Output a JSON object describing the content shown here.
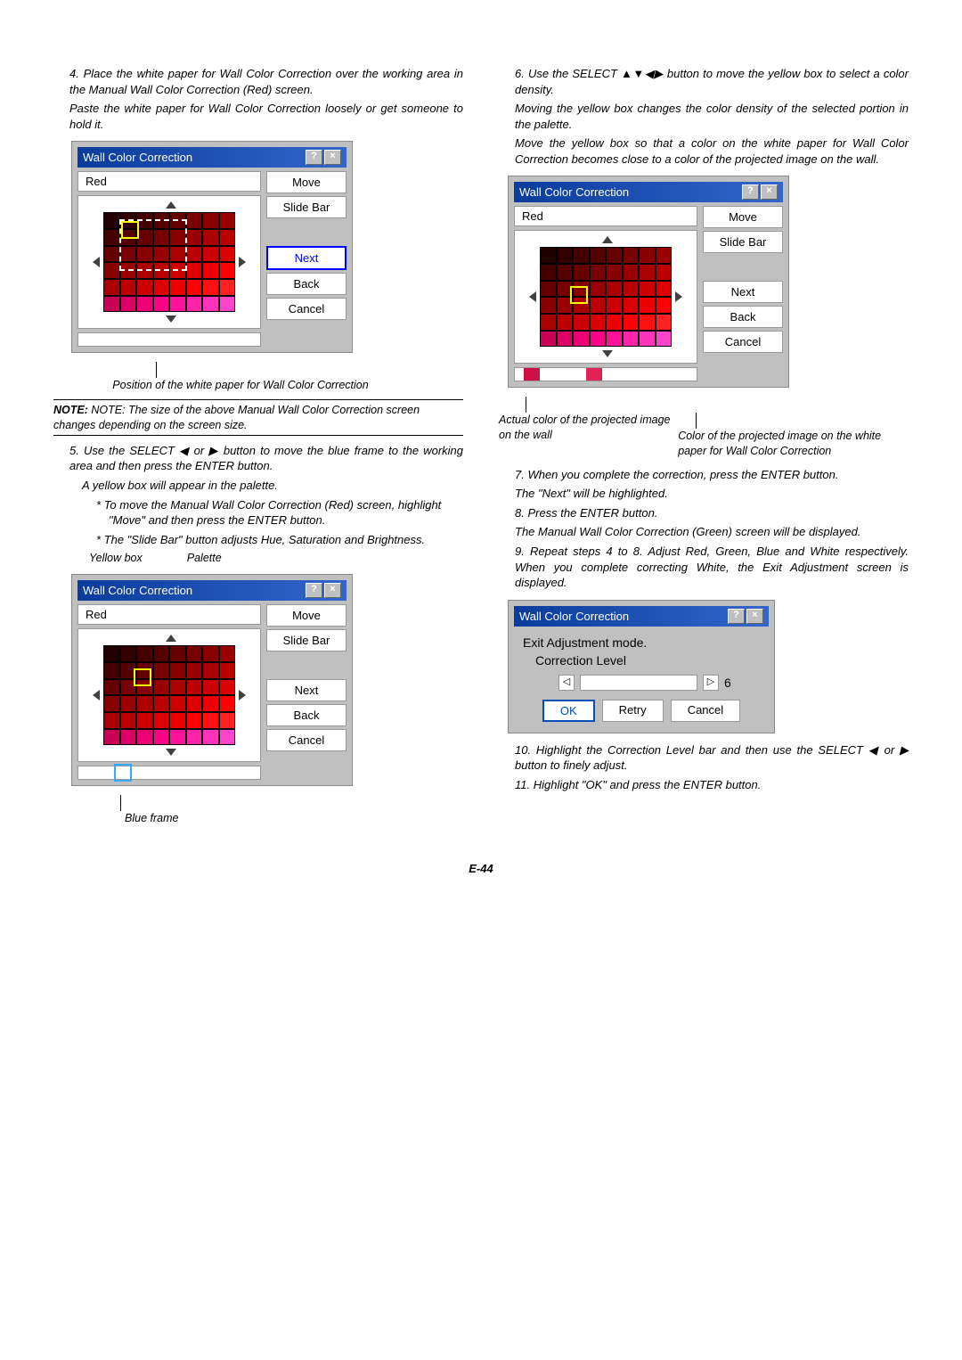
{
  "page_number": "E-44",
  "left": {
    "s4a": "4. Place the white paper for Wall Color Correction over the working area in the Manual Wall Color Correction (Red) screen.",
    "s4b": "Paste the white paper for Wall Color Correction loosely or get someone to hold it.",
    "dlg1_caption": "Position of the white paper for Wall Color Correction",
    "note": "NOTE: The size of the above Manual Wall Color Correction screen changes depending on the screen size.",
    "s5a": "5. Use the SELECT ◀ or ▶ button to move the blue frame to the working area and then press the ENTER button.",
    "s5b": "A yellow box will appear in the palette.",
    "s5c": "*   To move the Manual Wall Color Correction (Red) screen, highlight \"Move\" and then press the ENTER button.",
    "s5d": "*   The \"Slide Bar\" button adjusts Hue, Saturation and Brightness.",
    "annot_yellow": "Yellow box",
    "annot_palette": "Palette",
    "annot_blue": "Blue frame"
  },
  "right": {
    "s6a": "6. Use the SELECT ▲▼◀▶ button to move the yellow box to select a color density.",
    "s6b": "Moving the yellow box changes the color density of the selected portion in the palette.",
    "s6c": "Move the yellow box so that a color on the white paper for Wall Color Correction becomes close to a color of the projected image on the wall.",
    "dlg3_cap1": "Actual color of the projected image on the wall",
    "dlg3_cap2": "Color of the projected image on the white paper for Wall Color Correction",
    "s7a": "7. When you complete the correction, press the ENTER button.",
    "s7b": "The \"Next\" will be highlighted.",
    "s8a": "8. Press the ENTER button.",
    "s8b": "The Manual Wall Color Correction (Green) screen will be displayed.",
    "s9": "9. Repeat steps 4 to 8. Adjust Red, Green, Blue and White respectively. When you complete correcting White, the Exit Adjustment screen is displayed.",
    "s10": "10. Highlight the Correction Level bar and then use the SELECT ◀ or ▶ button to finely adjust.",
    "s11": "11. Highlight \"OK\" and press the ENTER button."
  },
  "dialog": {
    "title": "Wall Color Correction",
    "red": "Red",
    "btn_move": "Move",
    "btn_slide": "Slide Bar",
    "btn_next": "Next",
    "btn_back": "Back",
    "btn_cancel": "Cancel",
    "help": "?",
    "close": "×"
  },
  "exit": {
    "title": "Wall Color Correction",
    "l1": "Exit Adjustment mode.",
    "l2": "Correction Level",
    "val": "6",
    "ok": "OK",
    "retry": "Retry",
    "cancel": "Cancel"
  },
  "chart_data": {
    "type": "table",
    "title": "Wall Color Correction palette grid",
    "grid": {
      "rows": 6,
      "cols": 8
    },
    "note": "Palette shows red color-density gradient; yellow selection box movable over cells",
    "correction_level_value": 6,
    "correction_level_range": [
      0,
      10
    ]
  }
}
